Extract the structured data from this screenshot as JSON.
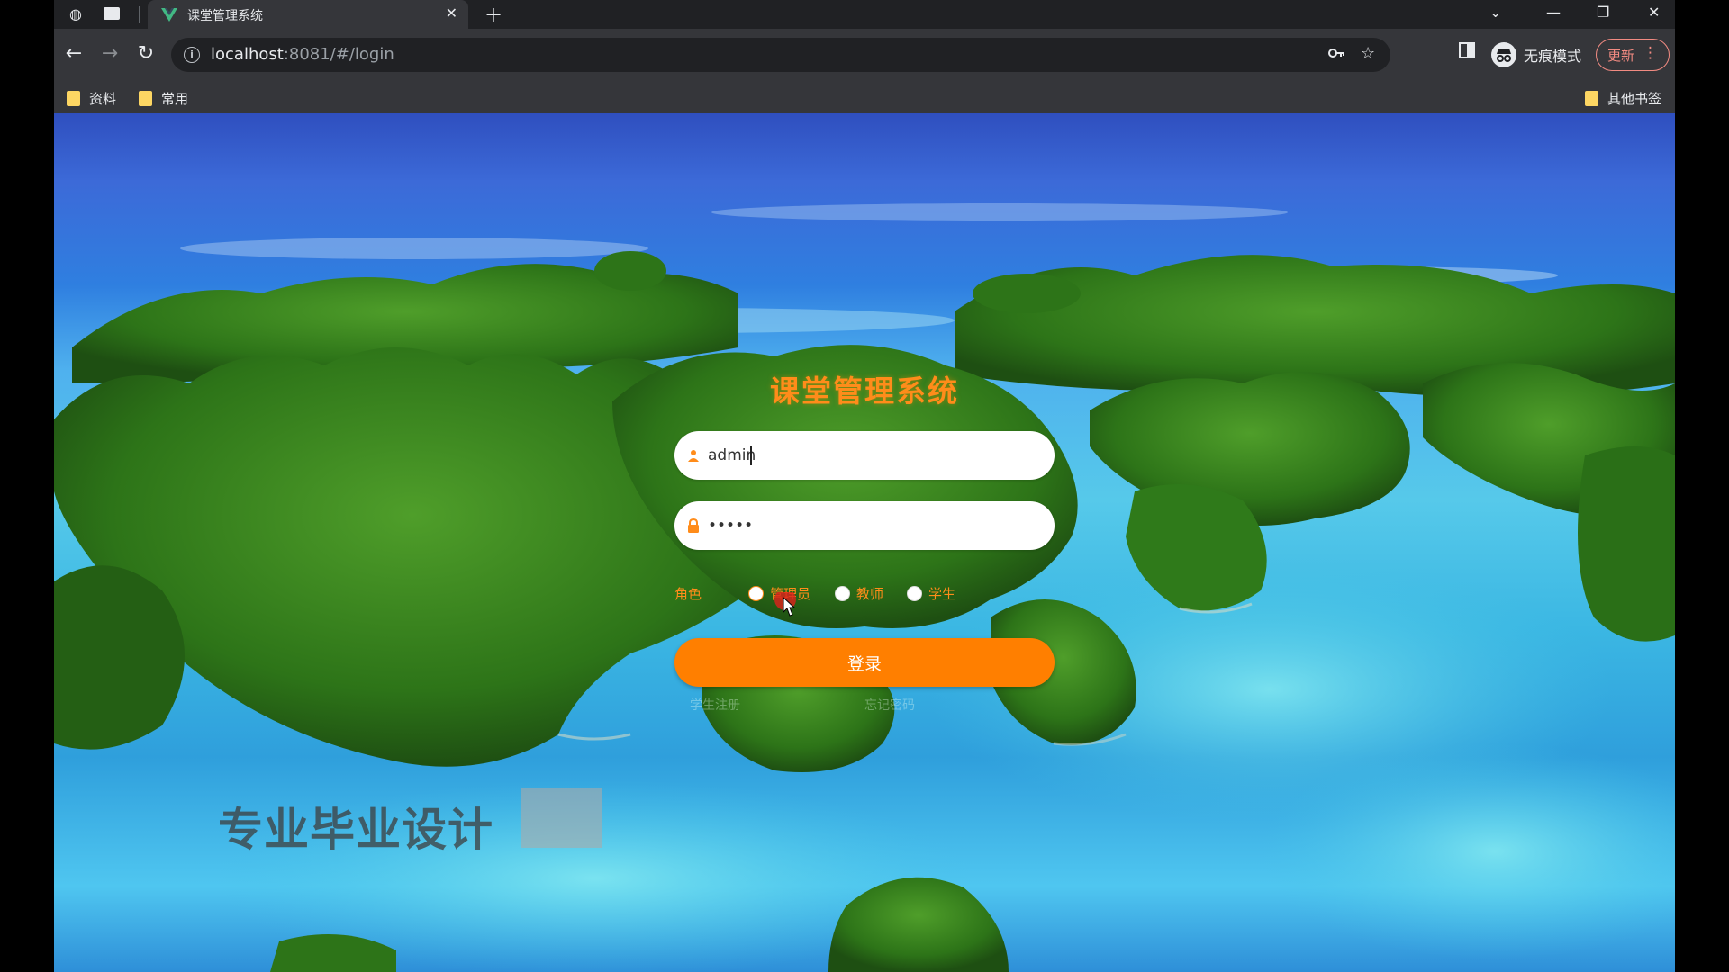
{
  "browser": {
    "tab": {
      "title": "课堂管理系统",
      "close": "✕",
      "favicon": "vue-logo-icon"
    },
    "new_tab": "+",
    "window": {
      "dropdown": "⌄",
      "minimize": "—",
      "restore": "❐",
      "close": "✕"
    },
    "nav": {
      "back": "←",
      "forward": "→",
      "reload": "↻"
    },
    "url_host": "localhost",
    "url_rest": ":8081/#/login",
    "incognito_label": "无痕模式",
    "update_label": "更新",
    "menu": "⋮",
    "bookmarks": [
      "资料",
      "常用"
    ],
    "other_bookmarks": "其他书签"
  },
  "login": {
    "title": "课堂管理系统",
    "username_value": "admin",
    "password_value": "•••••",
    "role_label": "角色",
    "roles": [
      "管理员",
      "教师",
      "学生"
    ],
    "selected_role": "管理员",
    "submit": "登录",
    "link_register": "学生注册",
    "link_forgot": "忘记密码"
  },
  "watermark": "专业毕业设计",
  "colors": {
    "accent": "#ff7f00",
    "title": "#ff8c1a",
    "browser_dark": "#202124",
    "browser_toolbar": "#35363a"
  }
}
